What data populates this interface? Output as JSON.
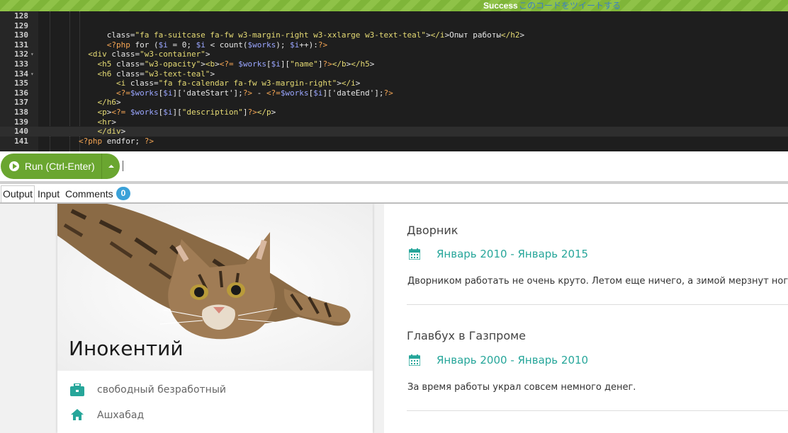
{
  "status": {
    "label": "Success",
    "tweet_link": "このコードをツイートする"
  },
  "editor": {
    "lines": [
      {
        "n": "128",
        "code": ""
      },
      {
        "n": "129",
        "code": ""
      },
      {
        "n": "130",
        "code": "              class=\"fa fa-suitcase fa-fw w3-margin-right w3-xxlarge w3-text-teal\"></i>Опыт работы</h2>"
      },
      {
        "n": "131",
        "code": "              <?php for ($i = 0; $i < count($works); $i++):?>"
      },
      {
        "n": "132",
        "code": "          <div class=\"w3-container\">"
      },
      {
        "n": "133",
        "code": "            <h5 class=\"w3-opacity\"><b><?= $works[$i][\"name\"]?></b></h5>"
      },
      {
        "n": "134",
        "code": "            <h6 class=\"w3-text-teal\">"
      },
      {
        "n": "135",
        "code": "                <i class=\"fa fa-calendar fa-fw w3-margin-right\"></i>"
      },
      {
        "n": "136",
        "code": "                <?=$works[$i]['dateStart'];?> - <?=$works[$i]['dateEnd'];?>"
      },
      {
        "n": "137",
        "code": "            </h6>"
      },
      {
        "n": "138",
        "code": "            <p><?= $works[$i][\"description\"]?></p>"
      },
      {
        "n": "139",
        "code": "            <hr>"
      },
      {
        "n": "140",
        "code": "            </div>"
      },
      {
        "n": "141",
        "code": "        <?php endfor; ?>"
      }
    ]
  },
  "toolbar": {
    "run_label": "Run (Ctrl-Enter)"
  },
  "tabs": [
    {
      "label": "Output"
    },
    {
      "label": "Input"
    },
    {
      "label": "Comments"
    }
  ],
  "comments_count": "0",
  "profile": {
    "name": "Инокентий",
    "job": "свободный безработный",
    "city": "Ашхабад"
  },
  "works": [
    {
      "name": "Дворник",
      "date": "Январь 2010 - Январь 2015",
      "description": "Дворником работать не очень круто. Летом еще ничего, а зимой мерзнут ноги."
    },
    {
      "name": "Главбух в Газпроме",
      "date": "Январь 2000 - Январь 2010",
      "description": "За время работы украл совсем немного денег."
    }
  ],
  "colors": {
    "teal": "#26a69a",
    "run_green": "#6aa630",
    "badge_blue": "#3aa1d8"
  }
}
